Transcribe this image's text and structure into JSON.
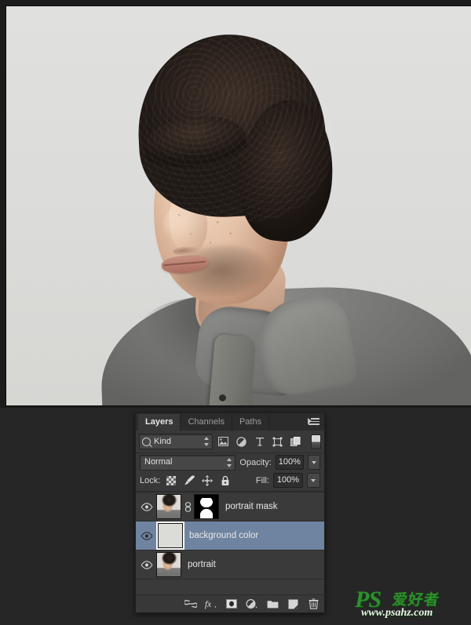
{
  "document": {
    "canvas_alt": "portrait photo of a young man with dark curly hair on light gray background"
  },
  "panel": {
    "tabs": [
      {
        "label": "Layers",
        "active": true
      },
      {
        "label": "Channels",
        "active": false
      },
      {
        "label": "Paths",
        "active": false
      }
    ],
    "menu_icon": "panel-menu-icon",
    "filter": {
      "kind_label": "Kind",
      "search_icon": "magnifier-icon",
      "icons": [
        "image-filter-icon",
        "adjustment-filter-icon",
        "type-filter-icon",
        "shape-filter-icon",
        "smart-object-filter-icon"
      ],
      "toggle_name": "filter-enable-toggle"
    },
    "blend": {
      "mode": "Normal",
      "opacity_label": "Opacity:",
      "opacity_value": "100%"
    },
    "lock": {
      "label": "Lock:",
      "icons": [
        "lock-transparent-pixels-icon",
        "lock-image-pixels-icon",
        "lock-position-icon",
        "lock-all-icon"
      ],
      "fill_label": "Fill:",
      "fill_value": "100%"
    },
    "layers": [
      {
        "name": "portrait mask",
        "visible": true,
        "selected": false,
        "has_mask": true,
        "linked": true,
        "thumb": "portrait-thumbnail",
        "mask_thumb": "layer-mask-thumbnail"
      },
      {
        "name": "background color",
        "visible": true,
        "selected": true,
        "has_mask": false,
        "linked": false,
        "thumb": "solid-color-thumbnail"
      },
      {
        "name": "portrait",
        "visible": true,
        "selected": false,
        "has_mask": false,
        "linked": false,
        "thumb": "portrait-thumbnail"
      }
    ],
    "footer_icons": [
      "link-layers-icon",
      "layer-style-fx-icon",
      "add-layer-mask-icon",
      "new-adjustment-layer-icon",
      "new-group-icon",
      "new-layer-icon",
      "delete-layer-icon"
    ]
  },
  "watermark": {
    "brand": "PS",
    "brand_cn": "爱好者",
    "url": "www.psahz.com",
    "color": "#2f8f2f"
  }
}
